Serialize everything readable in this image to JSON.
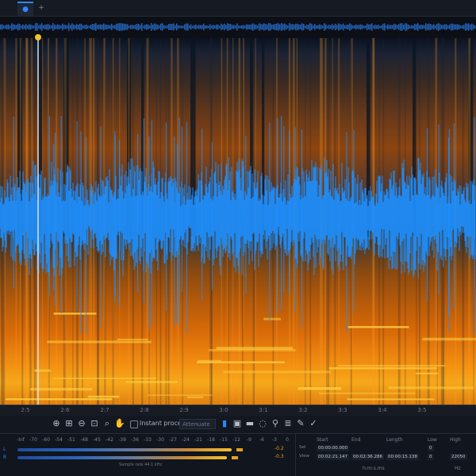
{
  "tabs": [
    {
      "label": "●",
      "icon": "file-tab-icon",
      "active": true
    },
    {
      "label": "+",
      "icon": "plus-icon",
      "active": false
    }
  ],
  "colors": {
    "accent": "#2f86ff",
    "waveform": "#1e90ff",
    "spectrogram_low": "#0a1220",
    "spectrogram_high": "#f7a81a",
    "playhead_knob": "#f2c12e"
  },
  "ruler": {
    "ticks": [
      "2:5",
      "2:6",
      "2:7",
      "2:8",
      "2:9",
      "3:0",
      "3:1",
      "3:2",
      "3:3",
      "3:4",
      "3:5"
    ]
  },
  "toolbar": {
    "tools": [
      {
        "icon": "zoom-in-icon",
        "glyph": "⊕"
      },
      {
        "icon": "zoom-fit-icon",
        "glyph": "⊞"
      },
      {
        "icon": "zoom-out-icon",
        "glyph": "⊖"
      },
      {
        "icon": "zoom-selection-icon",
        "glyph": "⊡"
      },
      {
        "icon": "magnifier-icon",
        "glyph": "⌕"
      },
      {
        "icon": "hand-icon",
        "glyph": "✋"
      }
    ],
    "instant_process_label": "Instant process",
    "mode_value": "Attenuate",
    "selection_tools": [
      {
        "icon": "time-selection-icon",
        "glyph": "▮",
        "active": true
      },
      {
        "icon": "time-frequency-selection-icon",
        "glyph": "▣",
        "active": false
      },
      {
        "icon": "frequency-selection-icon",
        "glyph": "▬",
        "active": false
      },
      {
        "icon": "lasso-icon",
        "glyph": "◌",
        "active": false
      },
      {
        "icon": "magic-wand-icon",
        "glyph": "⚲",
        "active": false
      },
      {
        "icon": "harmonic-selection-icon",
        "glyph": "≣",
        "active": false
      },
      {
        "icon": "brush-icon",
        "glyph": "✎",
        "active": false
      },
      {
        "icon": "check-icon",
        "glyph": "✓",
        "active": false
      }
    ]
  },
  "meter": {
    "scale": [
      "-Inf",
      "-70",
      "-60",
      "-54",
      "-51",
      "-48",
      "-45",
      "-42",
      "-39",
      "-36",
      "-33",
      "-30",
      "-27",
      "-24",
      "-21",
      "-18",
      "-15",
      "-12",
      "-9",
      "-6",
      "-3",
      "0"
    ],
    "left_label": "L",
    "right_label": "R",
    "left_level": 0.95,
    "right_level": 0.93,
    "left_peak": "-0.2",
    "right_peak": "-0.3",
    "footer": "Sample rate 44.1 kHz"
  },
  "selection": {
    "headers": [
      "Start",
      "End",
      "Length",
      "Low",
      "High"
    ],
    "rows": [
      {
        "label": "Sel",
        "values": [
          "00:00:00.000",
          "",
          "",
          "0",
          ""
        ]
      },
      {
        "label": "View",
        "values": [
          "00:02:21.147",
          "00:02:36.286",
          "00:00:15.138",
          "0",
          "22050"
        ]
      }
    ],
    "units_label": "h:m:s.ms",
    "hz_label": "Hz"
  }
}
